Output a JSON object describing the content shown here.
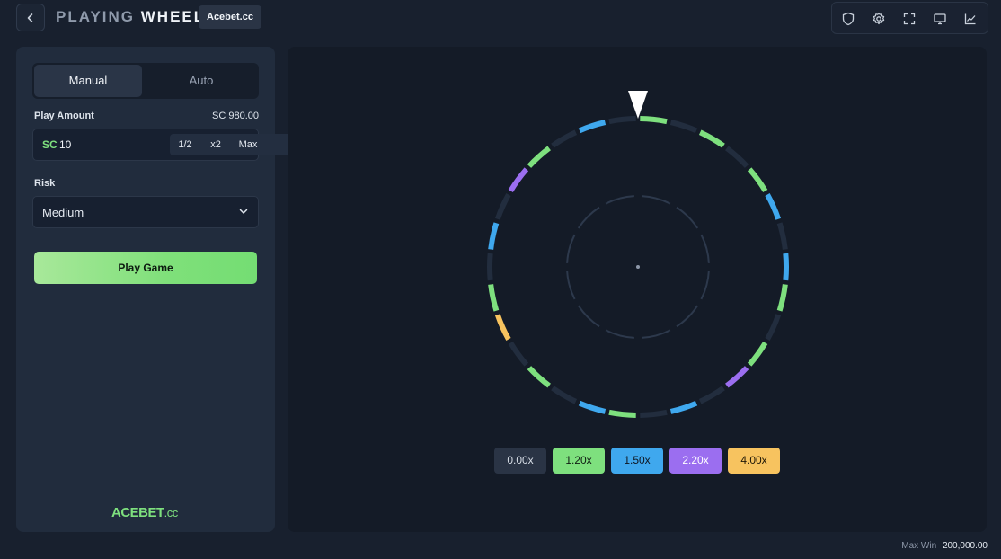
{
  "header": {
    "title_part1": "PLAYING",
    "title_part2": "WHEEL",
    "badge": "Acebet.cc",
    "icons": [
      "shield-icon",
      "gear-icon",
      "fullscreen-icon",
      "monitor-icon",
      "chart-icon"
    ]
  },
  "sidebar": {
    "tabs": [
      {
        "label": "Manual",
        "active": true
      },
      {
        "label": "Auto",
        "active": false
      }
    ],
    "play_amount_label": "Play Amount",
    "balance": "SC 980.00",
    "amount_currency": "SC",
    "amount_value": "10",
    "multipliers": [
      "1/2",
      "x2",
      "Max"
    ],
    "risk_label": "Risk",
    "risk_value": "Medium",
    "play_button": "Play Game",
    "logo_main": "ACEBET",
    "logo_suffix": ".cc"
  },
  "wheel": {
    "segments": [
      "green",
      "gray",
      "green",
      "gray",
      "green",
      "blue",
      "gray",
      "blue",
      "green",
      "gray",
      "green",
      "purple",
      "gray",
      "blue",
      "gray",
      "green",
      "blue",
      "gray",
      "green",
      "gray",
      "yellow",
      "green",
      "gray",
      "blue",
      "gray",
      "purple",
      "green",
      "gray",
      "blue",
      "gray"
    ],
    "colors": {
      "gray": "#222d3e",
      "green": "#7ee07e",
      "blue": "#3fa8ee",
      "purple": "#9b6ef0",
      "yellow": "#f7c35f"
    }
  },
  "payouts": [
    {
      "label": "0.00x",
      "bg": "#2a3445",
      "fg": "#d7dde6"
    },
    {
      "label": "1.20x",
      "bg": "#7ee07e",
      "fg": "#0f1b12"
    },
    {
      "label": "1.50x",
      "bg": "#3fa8ee",
      "fg": "#0f1722"
    },
    {
      "label": "2.20x",
      "bg": "#9b6ef0",
      "fg": "#ffffff"
    },
    {
      "label": "4.00x",
      "bg": "#f7c35f",
      "fg": "#1e1707"
    }
  ],
  "footer": {
    "max_win_label": "Max Win",
    "max_win_value": "200,000.00"
  }
}
